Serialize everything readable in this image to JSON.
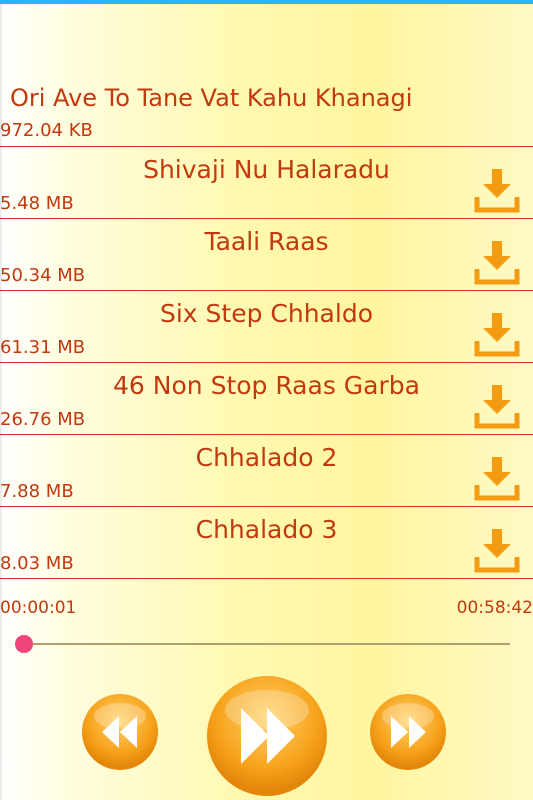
{
  "songs": [
    {
      "title": "Ori Ave To Tane Vat Kahu Khanagi",
      "size": "972.04 KB"
    },
    {
      "title": "Shivaji Nu Halaradu",
      "size": "5.48 MB"
    },
    {
      "title": "Taali Raas",
      "size": "50.34 MB"
    },
    {
      "title": "Six Step Chhaldo",
      "size": "61.31 MB"
    },
    {
      "title": "46 Non Stop Raas Garba",
      "size": "26.76 MB"
    },
    {
      "title": "Chhalado 2",
      "size": "7.88 MB"
    },
    {
      "title": "Chhalado 3",
      "size": "8.03 MB"
    }
  ],
  "player": {
    "current_time": "00:00:01",
    "total_time": "00:58:42",
    "progress": 0.0003
  },
  "colors": {
    "text": "#c0390f",
    "download_icon": "#f39c12",
    "seek_thumb": "#f0457a"
  },
  "icons": {
    "download": "download-icon",
    "previous": "rewind-icon",
    "play": "play-icon",
    "next": "fast-forward-icon"
  }
}
